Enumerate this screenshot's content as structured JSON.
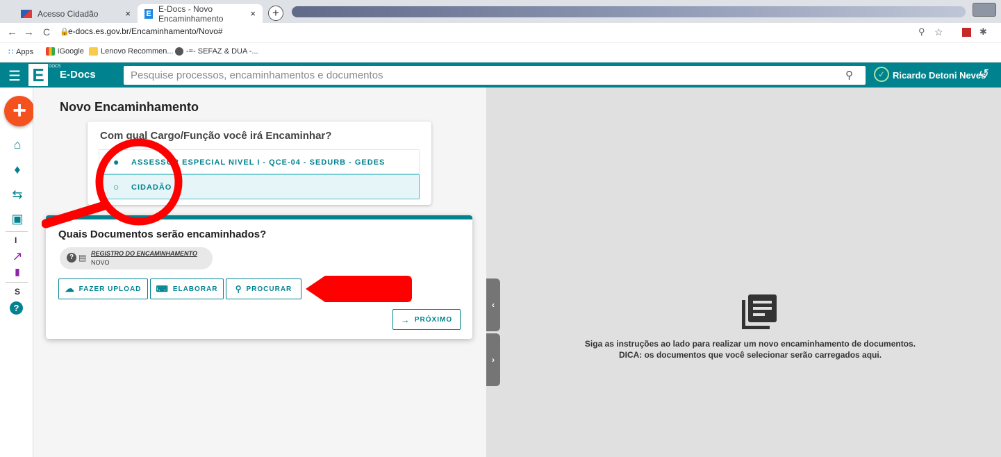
{
  "browser": {
    "tabs": [
      {
        "title": "Acesso Cidadão",
        "close": "×"
      },
      {
        "title": "E-Docs - Novo Encaminhamento",
        "close": "×"
      }
    ],
    "new_tab": "+",
    "url": "e-docs.es.gov.br/Encaminhamento/Novo#",
    "nav": {
      "back": "←",
      "forward": "→",
      "reload": "C"
    },
    "bookmarks": [
      "Apps",
      "iGoogle",
      "Lenovo Recommen...",
      "-=- SEFAZ & DUA -..."
    ]
  },
  "header": {
    "app_name": "E-Docs",
    "logo_letter": "E",
    "logo_sub": "DOCS",
    "search_placeholder": "Pesquise processos, encaminhamentos e documentos",
    "user_name": "Ricardo Detoni Neves"
  },
  "sidebar": {
    "fab": "+",
    "labels": [
      "I",
      "S"
    ]
  },
  "main": {
    "page_title": "Novo Encaminhamento",
    "role_question": "Com qual Cargo/Função você irá Encaminhar?",
    "roles": [
      {
        "label": "ASSESSOR ESPECIAL NIVEL I - QCE-04 - SEDURB - GEDES",
        "selected": false
      },
      {
        "label": "CIDADÃO",
        "selected": true
      }
    ],
    "docs_question": "Quais Documentos serão encaminhados?",
    "chip": {
      "title": "REGISTRO DO ENCAMINHAMENTO",
      "subtitle": "NOVO"
    },
    "buttons": {
      "upload": "FAZER UPLOAD",
      "elaborar": "ELABORAR",
      "procurar": "PROCURAR",
      "proximo": "PRÓXIMO"
    }
  },
  "right_panel": {
    "hint_line1": "Siga as instruções ao lado para realizar um novo encaminhamento de documentos.",
    "hint_line2": "DICA: os documentos que você selecionar serão carregados aqui."
  },
  "colors": {
    "primary": "#00838f",
    "fab": "#f4511e",
    "annotation_red": "#ff0000"
  }
}
